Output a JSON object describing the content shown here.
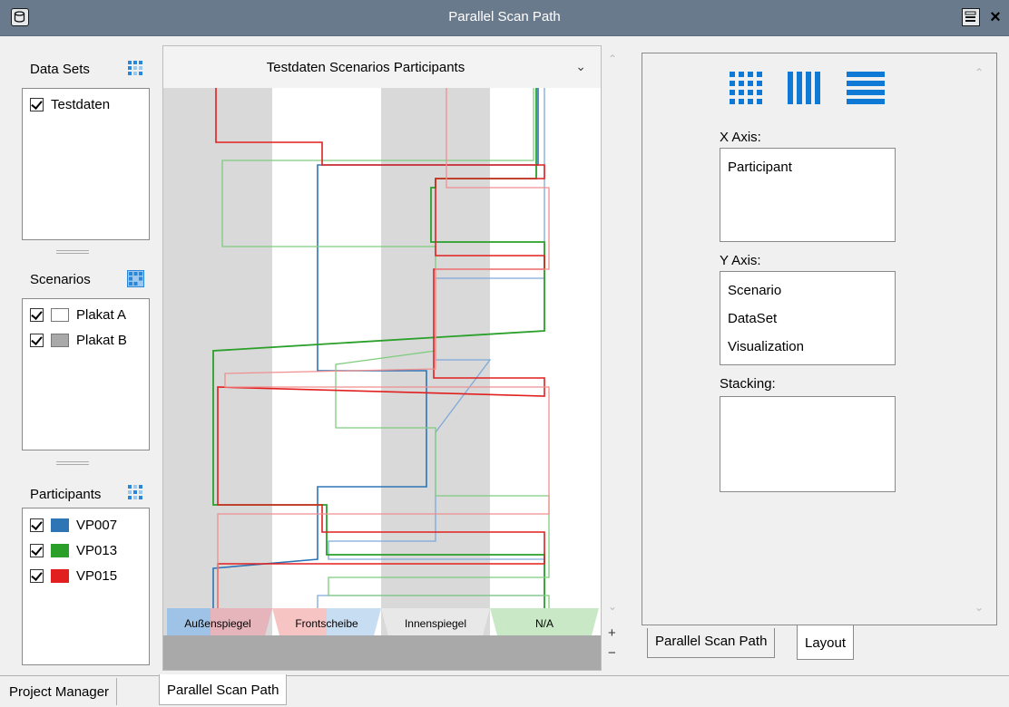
{
  "window": {
    "title": "Parallel Scan Path"
  },
  "data_sets": {
    "label": "Data Sets",
    "items": [
      {
        "label": "Testdaten",
        "checked": true
      }
    ]
  },
  "scenarios": {
    "label": "Scenarios",
    "items": [
      {
        "label": "Plakat A",
        "checked": true,
        "color": "#ffffff"
      },
      {
        "label": "Plakat B",
        "checked": true,
        "color": "#a9a9a9"
      }
    ]
  },
  "participants": {
    "label": "Participants",
    "items": [
      {
        "label": "VP007",
        "checked": true,
        "color": "#2e75b6"
      },
      {
        "label": "VP013",
        "checked": true,
        "color": "#2aa02b"
      },
      {
        "label": "VP015",
        "checked": true,
        "color": "#e11f1f"
      }
    ]
  },
  "center": {
    "header": "Testdaten Scenarios Participants",
    "aois": [
      {
        "label": "Außenspiegel",
        "stripe": "#d9d9d9"
      },
      {
        "label": "Frontscheibe",
        "stripe": "#ffffff"
      },
      {
        "label": "Innenspiegel",
        "stripe": "#d9d9d9"
      },
      {
        "label": "N/A",
        "stripe": "#ffffff"
      }
    ],
    "zoom_in": "+",
    "zoom_out": "−"
  },
  "layout_panel": {
    "x_axis": {
      "label": "X Axis:",
      "items": [
        "Participant"
      ]
    },
    "y_axis": {
      "label": "Y Axis:",
      "items": [
        "Scenario",
        "DataSet",
        "Visualization"
      ]
    },
    "stacking": {
      "label": "Stacking:",
      "items": []
    }
  },
  "tabs": {
    "inner": [
      "Parallel Scan Path",
      "Layout"
    ],
    "inner_active": "Layout",
    "bottom": [
      "Project Manager",
      "Parallel Scan Path"
    ],
    "bottom_active": "Parallel Scan Path"
  },
  "colors": {
    "titlebar": "#697a8c",
    "accent_icon": "#0e7ad6"
  }
}
